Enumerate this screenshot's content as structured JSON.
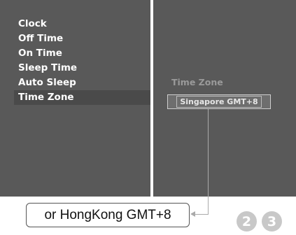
{
  "menu": {
    "items": [
      {
        "label": "Clock",
        "selected": false
      },
      {
        "label": "Off Time",
        "selected": false
      },
      {
        "label": "On Time",
        "selected": false
      },
      {
        "label": "Sleep Time",
        "selected": false
      },
      {
        "label": "Auto Sleep",
        "selected": false
      },
      {
        "label": "Time Zone",
        "selected": true
      }
    ]
  },
  "detail": {
    "label": "Time Zone",
    "value": "Singapore GMT+8"
  },
  "callout": {
    "text": "or HongKong GMT+8"
  },
  "steps": [
    "2",
    "3"
  ],
  "colors": {
    "panel": "#595959",
    "selected_row": "#4a4a4a",
    "badge": "#c8c8c8"
  }
}
